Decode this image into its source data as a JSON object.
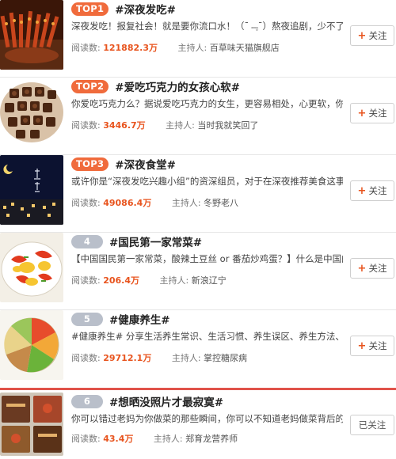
{
  "topics": [
    {
      "rank": "TOP1",
      "title": "#深夜发吃#",
      "desc": "深夜发吃！报复社会！就是要你流口水！（¯﹃¯）熬夜追剧，少不了这一",
      "read_label": "阅读数:",
      "read_count": "121882.3万",
      "host_label": "主持人:",
      "host": "百草味天猫旗舰店",
      "follow_label": "关注",
      "followed": false
    },
    {
      "rank": "TOP2",
      "title": "#爱吃巧克力的女孩心软#",
      "desc": "你爱吃巧克力么？据说爱吃巧克力的女生，更容易相处，心更软，你是么？",
      "read_label": "阅读数:",
      "read_count": "3446.7万",
      "host_label": "主持人:",
      "host": "当时我就笑回了",
      "follow_label": "关注",
      "followed": false
    },
    {
      "rank": "TOP3",
      "title": "#深夜食堂#",
      "desc": "或许你是“深夜发吃兴趣小组”的资深组员，对于在深夜推荐美食这事特别…",
      "read_label": "阅读数:",
      "read_count": "49086.4万",
      "host_label": "主持人:",
      "host": "冬野老八",
      "follow_label": "关注",
      "followed": false
    },
    {
      "rank": "4",
      "title": "#国民第一家常菜#",
      "desc": "【中国国民第一家常菜，酸辣土豆丝 or 番茄炒鸡蛋？】什么是中国的“第…",
      "read_label": "阅读数:",
      "read_count": "206.4万",
      "host_label": "主持人:",
      "host": "新浪辽宁",
      "follow_label": "关注",
      "followed": false
    },
    {
      "rank": "5",
      "title": "#健康养生#",
      "desc": "#健康养生# 分享生活养生常识、生活习惯、养生误区、养生方法、名人养…",
      "read_label": "阅读数:",
      "read_count": "29712.1万",
      "host_label": "主持人:",
      "host": "掌控糖尿病",
      "follow_label": "关注",
      "followed": false
    },
    {
      "rank": "6",
      "title": "#想晒没照片才最寂寞#",
      "desc": "你可以错过老妈为你做菜的那些瞬间，你可以不知道老妈做菜背后的故事…",
      "read_label": "阅读数:",
      "read_count": "43.4万",
      "host_label": "主持人:",
      "host": "郑育龙营养师",
      "follow_label": "已关注",
      "followed": true
    }
  ]
}
